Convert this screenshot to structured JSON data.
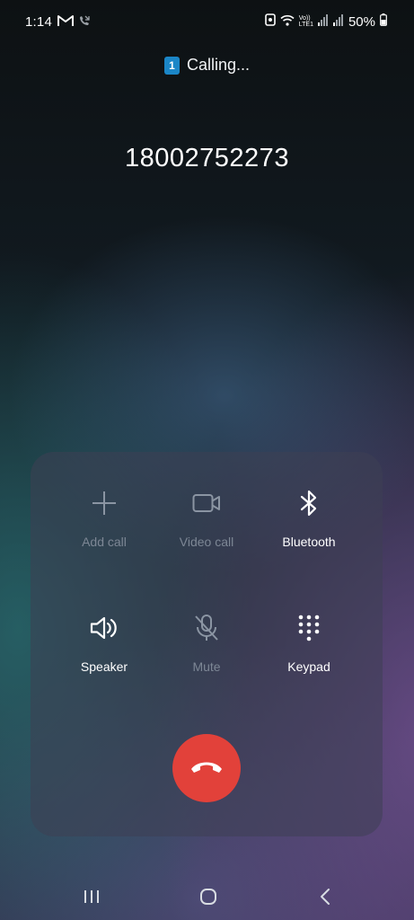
{
  "status_bar": {
    "time": "1:14",
    "battery_percent": "50%",
    "network_label_top": "Vo))",
    "network_label_bottom": "LTE1",
    "icons": [
      "gmail-icon",
      "missed-call-icon",
      "profile-lock-icon",
      "wifi-icon",
      "volte-icon",
      "signal-icon",
      "signal-icon-2",
      "battery-icon"
    ]
  },
  "call": {
    "sim_number": "1",
    "status_text": "Calling...",
    "number": "18002752273"
  },
  "controls": {
    "add_call": {
      "label": "Add call",
      "icon": "plus-icon",
      "enabled": false
    },
    "video_call": {
      "label": "Video call",
      "icon": "video-camera-icon",
      "enabled": false
    },
    "bluetooth": {
      "label": "Bluetooth",
      "icon": "bluetooth-icon",
      "enabled": true
    },
    "speaker": {
      "label": "Speaker",
      "icon": "speaker-icon",
      "enabled": true
    },
    "mute": {
      "label": "Mute",
      "icon": "microphone-muted-icon",
      "enabled": false
    },
    "keypad": {
      "label": "Keypad",
      "icon": "keypad-icon",
      "enabled": true
    }
  },
  "end_call": {
    "icon": "end-call-icon",
    "color": "#e2413a"
  },
  "nav_bar": {
    "buttons": [
      "recent-apps-icon",
      "home-icon",
      "back-icon"
    ]
  },
  "colors": {
    "accent_end_call": "#e2413a",
    "sim_badge": "#1b86c7",
    "disabled_label": "#7d8795"
  }
}
